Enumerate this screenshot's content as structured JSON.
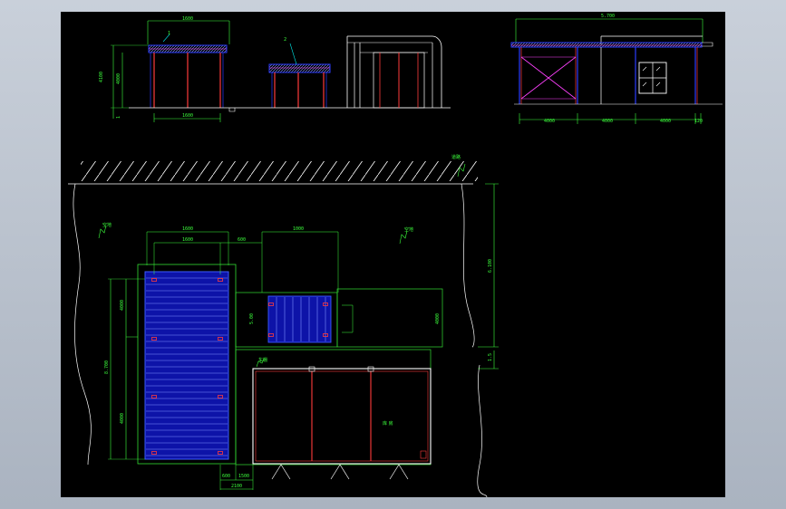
{
  "dims": {
    "top_width": "1600",
    "top_inner": "1600",
    "top_height_a": "4100",
    "top_height_b": "4000",
    "top_base": "1",
    "right_total": "5.700",
    "right_a": "4000",
    "right_b": "4000",
    "right_c": "4000",
    "right_d": "120",
    "plan_w1": "1600",
    "plan_w2": "1600",
    "plan_w3": "600",
    "plan_w4": "1000",
    "plan_h_total": "8.700",
    "plan_h1": "4000",
    "plan_h2": "4000",
    "plan_side": "5.00",
    "plan_right": "4000",
    "plan_bottom1": "600",
    "plan_bottom2": "1500",
    "plan_bottom_total": "2100",
    "plan_vert_total": "6.100",
    "plan_vert_small": "1.5"
  },
  "tags": {
    "tag1": "1",
    "tag2": "2",
    "site_left": "空地",
    "site_right": "空地",
    "site_top": "道路",
    "room_label": "库 房",
    "room_tag": "车棚"
  },
  "colors": {
    "dim": "#3cff3c",
    "outline": "#ffffff",
    "structure": "#ff3b3b",
    "roof": "#2b3cff",
    "accent": "#ff40ff",
    "frame": "#33dd33"
  }
}
